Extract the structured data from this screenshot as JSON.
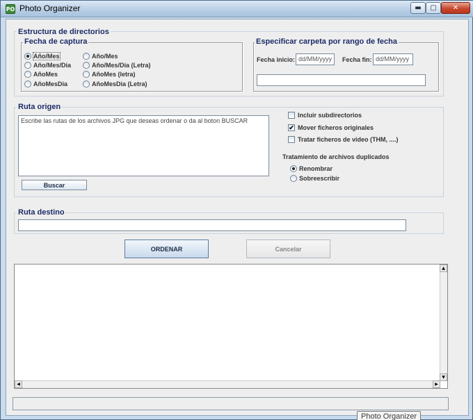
{
  "window": {
    "title": "Photo Organizer",
    "app_icon_text": "PO",
    "minimize_glyph": "▬",
    "maximize_glyph": "▢",
    "close_glyph": "✕"
  },
  "directory_structure": {
    "title": "Estructura de directorios",
    "capture_date": {
      "title": "Fecha de captura",
      "options_left": [
        {
          "label": "Año/Mes",
          "selected": true
        },
        {
          "label": "Año/Mes/Dia",
          "selected": false
        },
        {
          "label": "AñoMes",
          "selected": false
        },
        {
          "label": "AñoMesDia",
          "selected": false
        }
      ],
      "options_right": [
        {
          "label": "Año/Mes",
          "selected": false
        },
        {
          "label": "Año/Mes/Dia (Letra)",
          "selected": false
        },
        {
          "label": "AñoMes (letra)",
          "selected": false
        },
        {
          "label": "AñoMesDia (Letra)",
          "selected": false
        }
      ]
    },
    "date_range": {
      "title": "Especificar carpeta por rango de fecha",
      "start_label": "Fecha inicio:",
      "start_placeholder": "dd/MM/yyyy",
      "end_label": "Fecha fin:",
      "end_placeholder": "dd/MM/yyyy",
      "folder_value": ""
    }
  },
  "source": {
    "title": "Ruta origen",
    "paths_placeholder": "Escribe las rutas de los archivos JPG que deseas ordenar o da al boton BUSCAR",
    "search_label": "Buscar",
    "include_subdirs": {
      "label": "Incluir subdirectorios",
      "checked": false
    },
    "move_originals": {
      "label": "Mover ficheros originales",
      "checked": true
    },
    "process_video": {
      "label": "Tratar ficheros de video (THM, ....)",
      "checked": false
    },
    "duplicates_title": "Tratamiento de archivos duplicados",
    "duplicates": [
      {
        "label": "Renombrar",
        "selected": true
      },
      {
        "label": "Sobreescribir",
        "selected": false
      }
    ]
  },
  "destination": {
    "title": "Ruta destino",
    "value": ""
  },
  "actions": {
    "sort_label": "ORDENAR",
    "cancel_label": "Cancelar"
  },
  "log": {
    "text": "",
    "up_arrow": "▲",
    "down_arrow": "▼",
    "left_arrow": "◀",
    "right_arrow": "▶"
  },
  "status": {
    "text": ""
  },
  "tooltip": {
    "text": "Photo Organizer"
  }
}
